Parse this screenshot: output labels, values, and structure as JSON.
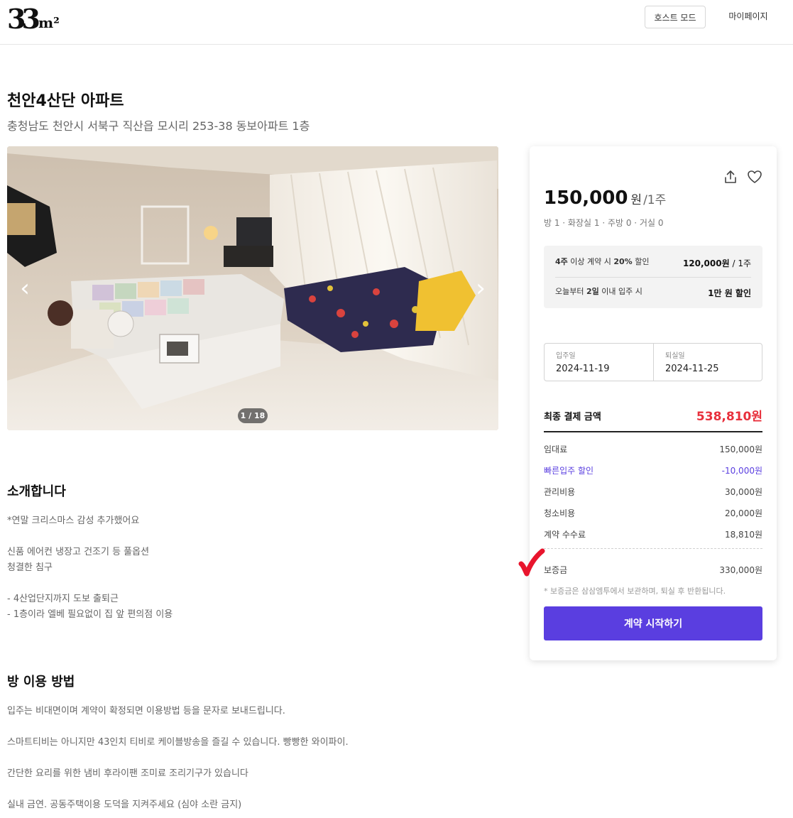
{
  "header": {
    "logo_big": "33",
    "logo_small": "m²",
    "host_mode": "호스트 모드",
    "my_page": "마이페이지"
  },
  "listing": {
    "title": "천안4산단 아파트",
    "address": "충청남도 천안시 서북구 직산읍 모시리 253-38 동보아파트 1층"
  },
  "gallery": {
    "counter": "1 / 18",
    "prev_icon": "‹",
    "next_icon": "›"
  },
  "intro": {
    "heading": "소개합니다",
    "lines": [
      "*연말 크리스마스 감성 추가했어요",
      "신품 에어컨 냉장고 건조기 등 풀옵션",
      "청결한 침구",
      "- 4산업단지까지 도보 출퇴근",
      "- 1층이라 엘베 필요없이 집 앞 편의점 이용"
    ]
  },
  "usage": {
    "heading": "방 이용 방법",
    "lines": [
      "입주는 비대면이며 계약이 확정되면 이용방법 등을 문자로 보내드립니다.",
      "스마트티비는 아니지만 43인치 티비로 케이블방송을 즐길 수 있습니다. 빵빵한 와이파이.",
      "간단한 요리를 위한 냄비 후라이팬 조미료 조리기구가 있습니다",
      "실내 금연. 공동주택이용 도덕을 지켜주세요 (심야 소란 금지)"
    ]
  },
  "booking": {
    "price": "150,000",
    "price_unit": "원",
    "price_per": "/1주",
    "rooms": "방 1 · 화장실 1 · 주방 0 · 거실 0",
    "promo": {
      "row1_a": "4주",
      "row1_b": " 이상 계약 시 ",
      "row1_c": "20%",
      "row1_d": " 할인",
      "row1_price": "120,000원",
      "row1_per": " / 1주",
      "row2_a": "오늘부터 ",
      "row2_b": "2일",
      "row2_c": " 이내 입주 시",
      "row2_right": "1만 원 할인"
    },
    "checkin_label": "입주일",
    "checkin_value": "2024-11-19",
    "checkout_label": "퇴실일",
    "checkout_value": "2024-11-25",
    "total_label": "최종 결제 금액",
    "total_value": "538,810원",
    "fees": [
      {
        "label": "임대료",
        "value": "150,000원"
      },
      {
        "label": "빠른입주 할인",
        "value": "-10,000원"
      },
      {
        "label": "관리비용",
        "value": "30,000원"
      },
      {
        "label": "청소비용",
        "value": "20,000원"
      },
      {
        "label": "계약 수수료",
        "value": "18,810원"
      }
    ],
    "deposit_label": "보증금",
    "deposit_value": "330,000원",
    "note": "* 보증금은 삼삼엠투에서 보관하며, 퇴실 후 반환됩니다.",
    "cta": "계약 시작하기"
  },
  "colors": {
    "accent": "#5a3ee0",
    "total_red": "#e8303c",
    "annotation_red": "#e8152d"
  },
  "icons": [
    "share-icon",
    "heart-icon",
    "chevron-left-icon",
    "chevron-right-icon",
    "checkmark-annotation"
  ]
}
